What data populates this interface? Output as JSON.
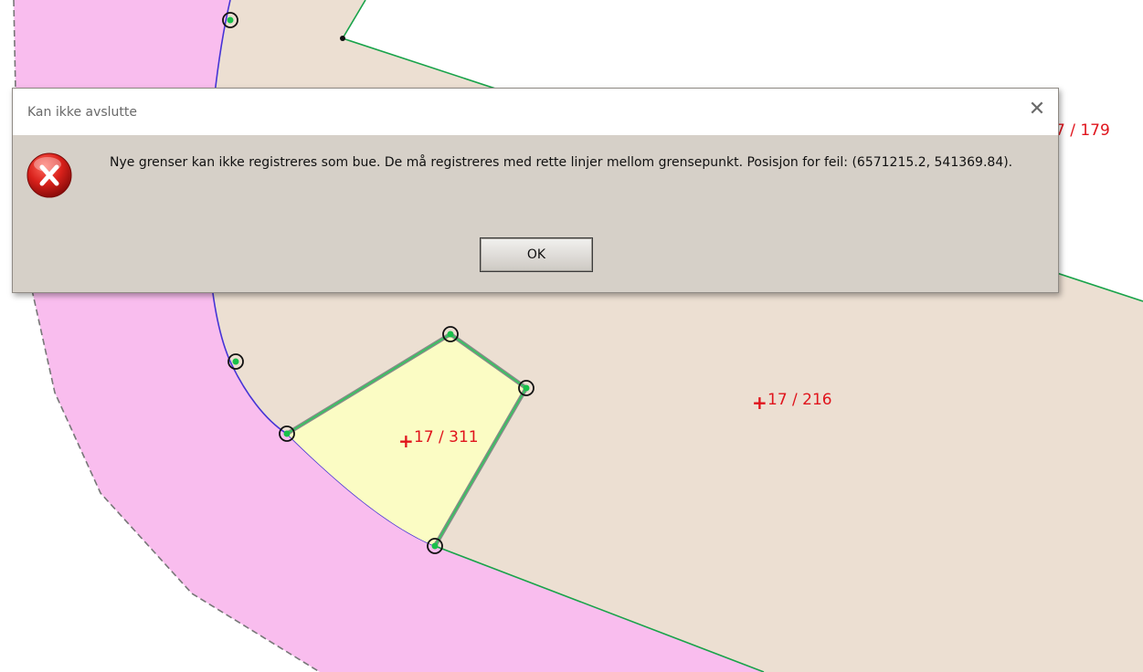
{
  "map": {
    "parcel_labels": {
      "p179": "7 / 179",
      "p216": "17 / 216",
      "p311": "17 / 311"
    }
  },
  "dialog": {
    "title": "Kan ikke avslutte",
    "close_glyph": "✕",
    "icon": "error-icon",
    "message": "Nye grenser kan ikke registreres som bue. De må registreres med rette linjer mellom grensepunkt. Posisjon for feil: (6571215.2, 541369.84).",
    "ok_label": "OK"
  },
  "colors": {
    "road_fill": "#f9bdee",
    "parcel_fill": "#ecdfd2",
    "selected_parcel_fill": "#fbfcc4",
    "boundary_line": "#19a34a",
    "arc_line": "#4634d6",
    "label_red": "#e0141c",
    "dialog_bg": "#d6d0c8"
  }
}
